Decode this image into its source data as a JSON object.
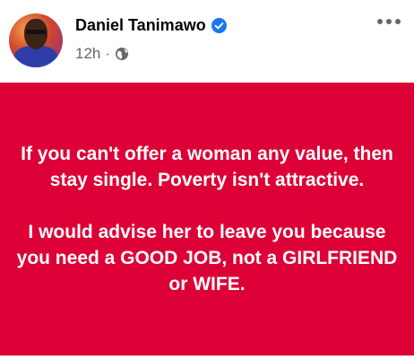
{
  "header": {
    "author_name": "Daniel Tanimawo",
    "timestamp": "12h",
    "separator": "·",
    "verified_icon": "verified-badge-icon",
    "audience_icon": "globe-icon",
    "more_icon": "more-options-icon"
  },
  "post": {
    "background_color": "#dd0037",
    "text_color": "#ffffff",
    "paragraph_1": "If you can't offer a woman any value, then stay single. Poverty isn't attractive.",
    "paragraph_2": "I would advise her to leave you because you need a GOOD JOB, not a GIRLFRIEND or WIFE."
  },
  "colors": {
    "verified_blue": "#1877f2",
    "meta_gray": "#65676b"
  }
}
